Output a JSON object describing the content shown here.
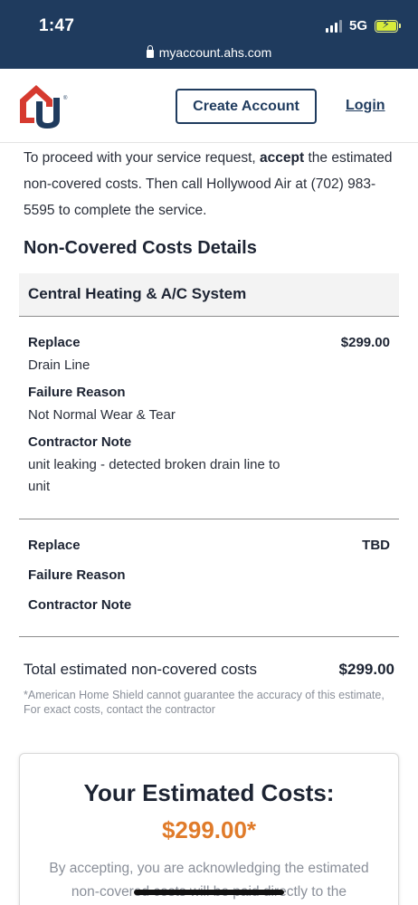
{
  "status_bar": {
    "time": "1:47",
    "network": "5G",
    "url": "myaccount.ahs.com"
  },
  "header": {
    "create_account_label": "Create Account",
    "login_label": "Login"
  },
  "intro": {
    "part1": "To proceed with your service request, ",
    "bold": "accept",
    "part2": " the estimated non-covered costs. Then call Hollywood Air at (702) 983-5595 to complete the service."
  },
  "section_title": "Non-Covered Costs Details",
  "system_name": "Central Heating & A/C System",
  "items": [
    {
      "action_label": "Replace",
      "price": "$299.00",
      "part": "Drain Line",
      "failure_label": "Failure Reason",
      "failure_value": "Not Normal Wear & Tear",
      "note_label": "Contractor Note",
      "note_value": "unit leaking - detected broken drain line to unit"
    },
    {
      "action_label": "Replace",
      "price": "TBD",
      "failure_label": "Failure Reason",
      "note_label": "Contractor Note"
    }
  ],
  "total": {
    "label": "Total estimated non-covered costs",
    "amount": "$299.00"
  },
  "disclaimer": "*American Home Shield cannot guarantee the accuracy of this estimate, For exact costs, contact the contractor",
  "estimate": {
    "title": "Your Estimated Costs:",
    "amount": "$299.00*",
    "text": "By accepting, you are acknowledging the estimated non-covered costs will be paid directly to the"
  },
  "colors": {
    "brand_navy": "#1f3b5e",
    "logo_red": "#d63a2f",
    "accent_orange": "#e07b2a"
  }
}
